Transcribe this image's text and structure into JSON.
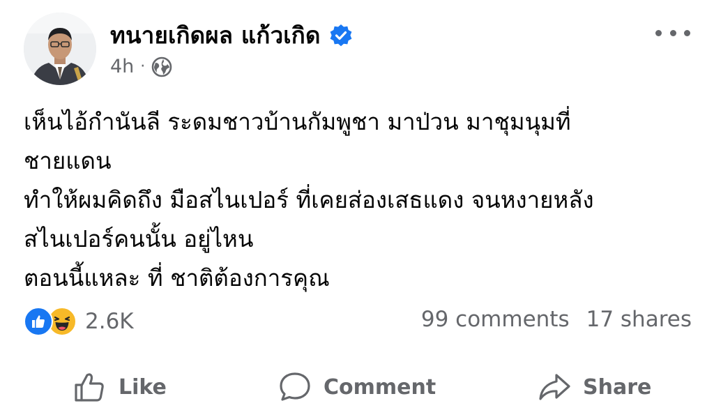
{
  "post": {
    "author": "ทนายเกิดผล แก้วเกิด",
    "verified": true,
    "timestamp": "4h",
    "separator": "·",
    "audience_icon": "globe-icon",
    "more_icon": "more-options-icon",
    "text_lines": [
      "เห็นไอ้กำนันลี ระดมชาวบ้านกัมพูชา มาป่วน มาชุมนุมที่",
      "ชายแดน",
      "ทำให้ผมคิดถึง มือสไนเปอร์ ที่เคยส่องเสธแดง จนหงายหลัง",
      "สไนเปอร์คนนั้น อยู่ไหน",
      "ตอนนี้แหละ ที่ ชาติต้องการคุณ"
    ]
  },
  "stats": {
    "reactions": [
      "like-reaction-icon",
      "haha-reaction-icon"
    ],
    "reaction_count": "2.6K",
    "comments": "99 comments",
    "shares": "17 shares"
  },
  "actions": {
    "like": "Like",
    "comment": "Comment",
    "share": "Share"
  },
  "colors": {
    "text": "#050505",
    "secondary": "#65676b",
    "accent": "#1877f2",
    "haha": "#f7b928"
  }
}
